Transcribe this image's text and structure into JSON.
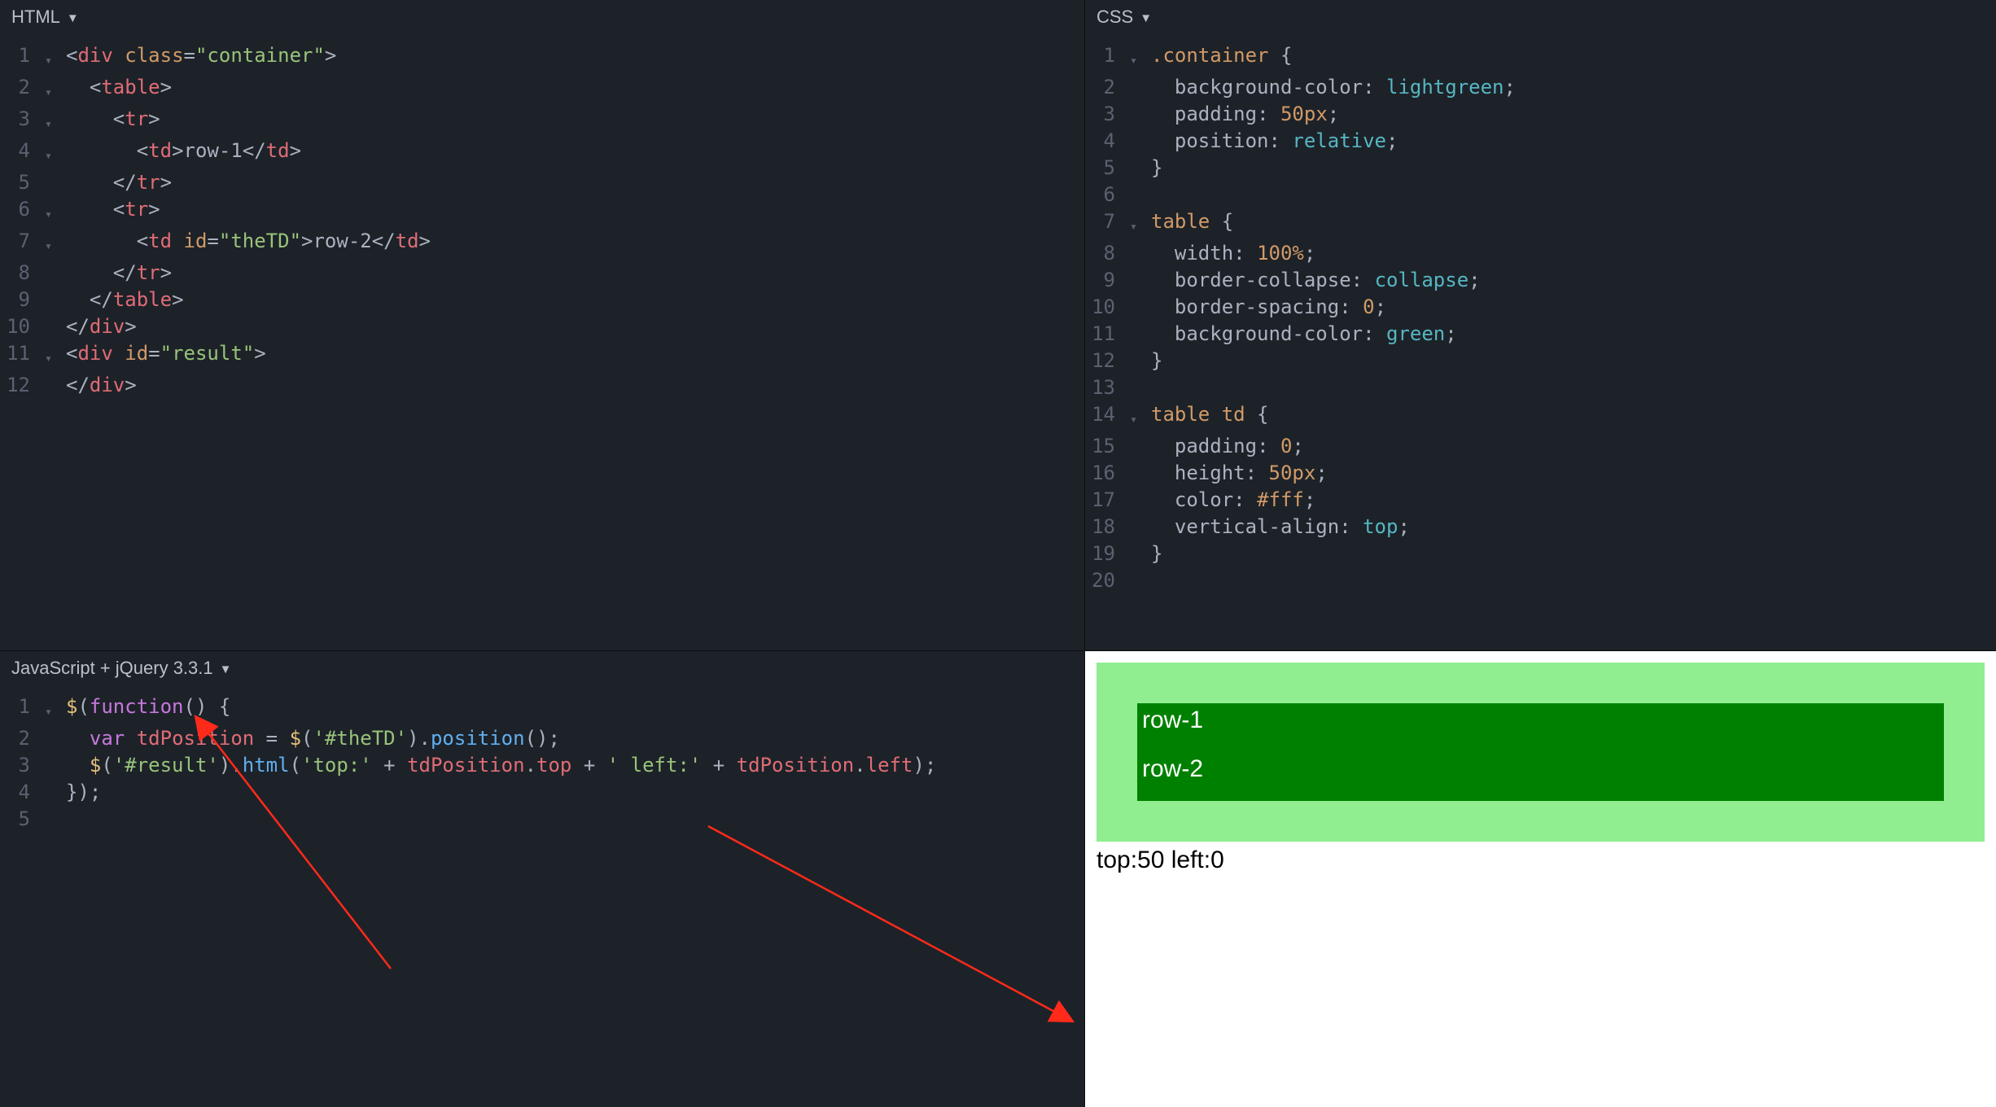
{
  "panes": {
    "html": {
      "title": "HTML"
    },
    "css": {
      "title": "CSS"
    },
    "js": {
      "title": "JavaScript + jQuery 3.3.1"
    }
  },
  "html_code": {
    "lines": [
      {
        "n": "1",
        "fold": "▾",
        "tokens": [
          [
            "angle",
            "<"
          ],
          [
            "tag",
            "div"
          ],
          [
            "text",
            " "
          ],
          [
            "attr",
            "class"
          ],
          [
            "eq",
            "="
          ],
          [
            "str",
            "\"container\""
          ],
          [
            "angle",
            ">"
          ]
        ]
      },
      {
        "n": "2",
        "fold": "▾",
        "tokens": [
          [
            "text",
            "  "
          ],
          [
            "angle",
            "<"
          ],
          [
            "tag",
            "table"
          ],
          [
            "angle",
            ">"
          ]
        ]
      },
      {
        "n": "3",
        "fold": "▾",
        "tokens": [
          [
            "text",
            "    "
          ],
          [
            "angle",
            "<"
          ],
          [
            "tag",
            "tr"
          ],
          [
            "angle",
            ">"
          ]
        ]
      },
      {
        "n": "4",
        "fold": "▾",
        "tokens": [
          [
            "text",
            "      "
          ],
          [
            "angle",
            "<"
          ],
          [
            "tag",
            "td"
          ],
          [
            "angle",
            ">"
          ],
          [
            "text",
            "row-1"
          ],
          [
            "angle",
            "</"
          ],
          [
            "tag",
            "td"
          ],
          [
            "angle",
            ">"
          ]
        ]
      },
      {
        "n": "5",
        "fold": "",
        "tokens": [
          [
            "text",
            "    "
          ],
          [
            "angle",
            "</"
          ],
          [
            "tag",
            "tr"
          ],
          [
            "angle",
            ">"
          ]
        ]
      },
      {
        "n": "6",
        "fold": "▾",
        "tokens": [
          [
            "text",
            "    "
          ],
          [
            "angle",
            "<"
          ],
          [
            "tag",
            "tr"
          ],
          [
            "angle",
            ">"
          ]
        ]
      },
      {
        "n": "7",
        "fold": "▾",
        "tokens": [
          [
            "text",
            "      "
          ],
          [
            "angle",
            "<"
          ],
          [
            "tag",
            "td"
          ],
          [
            "text",
            " "
          ],
          [
            "attr",
            "id"
          ],
          [
            "eq",
            "="
          ],
          [
            "str",
            "\"theTD\""
          ],
          [
            "angle",
            ">"
          ],
          [
            "text",
            "row-2"
          ],
          [
            "angle",
            "</"
          ],
          [
            "tag",
            "td"
          ],
          [
            "angle",
            ">"
          ]
        ]
      },
      {
        "n": "8",
        "fold": "",
        "tokens": [
          [
            "text",
            "    "
          ],
          [
            "angle",
            "</"
          ],
          [
            "tag",
            "tr"
          ],
          [
            "angle",
            ">"
          ]
        ]
      },
      {
        "n": "9",
        "fold": "",
        "tokens": [
          [
            "text",
            "  "
          ],
          [
            "angle",
            "</"
          ],
          [
            "tag",
            "table"
          ],
          [
            "angle",
            ">"
          ]
        ]
      },
      {
        "n": "10",
        "fold": "",
        "tokens": [
          [
            "angle",
            "</"
          ],
          [
            "tag",
            "div"
          ],
          [
            "angle",
            ">"
          ]
        ]
      },
      {
        "n": "11",
        "fold": "▾",
        "tokens": [
          [
            "angle",
            "<"
          ],
          [
            "tag",
            "div"
          ],
          [
            "text",
            " "
          ],
          [
            "attr",
            "id"
          ],
          [
            "eq",
            "="
          ],
          [
            "str",
            "\"result\""
          ],
          [
            "angle",
            ">"
          ]
        ]
      },
      {
        "n": "12",
        "fold": "",
        "tokens": [
          [
            "angle",
            "</"
          ],
          [
            "tag",
            "div"
          ],
          [
            "angle",
            ">"
          ]
        ]
      }
    ]
  },
  "css_code": {
    "lines": [
      {
        "n": "1",
        "fold": "▾",
        "tokens": [
          [
            "sel",
            ".container"
          ],
          [
            "text",
            " "
          ],
          [
            "brace",
            "{"
          ]
        ]
      },
      {
        "n": "2",
        "fold": "",
        "tokens": [
          [
            "text",
            "  "
          ],
          [
            "prop",
            "background-color"
          ],
          [
            "colon",
            ": "
          ],
          [
            "valkw",
            "lightgreen"
          ],
          [
            "semi",
            ";"
          ]
        ]
      },
      {
        "n": "3",
        "fold": "",
        "tokens": [
          [
            "text",
            "  "
          ],
          [
            "prop",
            "padding"
          ],
          [
            "colon",
            ": "
          ],
          [
            "val",
            "50px"
          ],
          [
            "semi",
            ";"
          ]
        ]
      },
      {
        "n": "4",
        "fold": "",
        "tokens": [
          [
            "text",
            "  "
          ],
          [
            "prop",
            "position"
          ],
          [
            "colon",
            ": "
          ],
          [
            "valkw",
            "relative"
          ],
          [
            "semi",
            ";"
          ]
        ]
      },
      {
        "n": "5",
        "fold": "",
        "tokens": [
          [
            "brace",
            "}"
          ]
        ]
      },
      {
        "n": "6",
        "fold": "",
        "tokens": [
          [
            "text",
            ""
          ]
        ]
      },
      {
        "n": "7",
        "fold": "▾",
        "tokens": [
          [
            "sel",
            "table"
          ],
          [
            "text",
            " "
          ],
          [
            "brace",
            "{"
          ]
        ]
      },
      {
        "n": "8",
        "fold": "",
        "tokens": [
          [
            "text",
            "  "
          ],
          [
            "prop",
            "width"
          ],
          [
            "colon",
            ": "
          ],
          [
            "val",
            "100%"
          ],
          [
            "semi",
            ";"
          ]
        ]
      },
      {
        "n": "9",
        "fold": "",
        "tokens": [
          [
            "text",
            "  "
          ],
          [
            "prop",
            "border-collapse"
          ],
          [
            "colon",
            ": "
          ],
          [
            "valkw",
            "collapse"
          ],
          [
            "semi",
            ";"
          ]
        ]
      },
      {
        "n": "10",
        "fold": "",
        "tokens": [
          [
            "text",
            "  "
          ],
          [
            "prop",
            "border-spacing"
          ],
          [
            "colon",
            ": "
          ],
          [
            "val",
            "0"
          ],
          [
            "semi",
            ";"
          ]
        ]
      },
      {
        "n": "11",
        "fold": "",
        "tokens": [
          [
            "text",
            "  "
          ],
          [
            "prop",
            "background-color"
          ],
          [
            "colon",
            ": "
          ],
          [
            "valkw",
            "green"
          ],
          [
            "semi",
            ";"
          ]
        ]
      },
      {
        "n": "12",
        "fold": "",
        "tokens": [
          [
            "brace",
            "}"
          ]
        ]
      },
      {
        "n": "13",
        "fold": "",
        "tokens": [
          [
            "text",
            ""
          ]
        ]
      },
      {
        "n": "14",
        "fold": "▾",
        "tokens": [
          [
            "sel",
            "table td"
          ],
          [
            "text",
            " "
          ],
          [
            "brace",
            "{"
          ]
        ]
      },
      {
        "n": "15",
        "fold": "",
        "tokens": [
          [
            "text",
            "  "
          ],
          [
            "prop",
            "padding"
          ],
          [
            "colon",
            ": "
          ],
          [
            "val",
            "0"
          ],
          [
            "semi",
            ";"
          ]
        ]
      },
      {
        "n": "16",
        "fold": "",
        "tokens": [
          [
            "text",
            "  "
          ],
          [
            "prop",
            "height"
          ],
          [
            "colon",
            ": "
          ],
          [
            "val",
            "50px"
          ],
          [
            "semi",
            ";"
          ]
        ]
      },
      {
        "n": "17",
        "fold": "",
        "tokens": [
          [
            "text",
            "  "
          ],
          [
            "prop",
            "color"
          ],
          [
            "colon",
            ": "
          ],
          [
            "val",
            "#fff"
          ],
          [
            "semi",
            ";"
          ]
        ]
      },
      {
        "n": "18",
        "fold": "",
        "tokens": [
          [
            "text",
            "  "
          ],
          [
            "prop",
            "vertical-align"
          ],
          [
            "colon",
            ": "
          ],
          [
            "valkw",
            "top"
          ],
          [
            "semi",
            ";"
          ]
        ]
      },
      {
        "n": "19",
        "fold": "",
        "tokens": [
          [
            "brace",
            "}"
          ]
        ]
      },
      {
        "n": "20",
        "fold": "",
        "tokens": [
          [
            "text",
            ""
          ]
        ]
      }
    ]
  },
  "js_code": {
    "lines": [
      {
        "n": "1",
        "fold": "▾",
        "tokens": [
          [
            "ident2",
            "$"
          ],
          [
            "paren",
            "("
          ],
          [
            "kw",
            "function"
          ],
          [
            "paren",
            "()"
          ],
          [
            "text",
            " "
          ],
          [
            "brace",
            "{"
          ]
        ]
      },
      {
        "n": "2",
        "fold": "",
        "tokens": [
          [
            "text",
            "  "
          ],
          [
            "kw",
            "var"
          ],
          [
            "text",
            " "
          ],
          [
            "ident",
            "tdPosition"
          ],
          [
            "text",
            " "
          ],
          [
            "eq",
            "="
          ],
          [
            "text",
            " "
          ],
          [
            "ident2",
            "$"
          ],
          [
            "paren",
            "("
          ],
          [
            "str",
            "'#theTD'"
          ],
          [
            "paren",
            ")"
          ],
          [
            "dot",
            "."
          ],
          [
            "fn",
            "position"
          ],
          [
            "paren",
            "()"
          ],
          [
            "semi",
            ";"
          ]
        ]
      },
      {
        "n": "3",
        "fold": "",
        "tokens": [
          [
            "text",
            "  "
          ],
          [
            "ident2",
            "$"
          ],
          [
            "paren",
            "("
          ],
          [
            "str",
            "'#result'"
          ],
          [
            "paren",
            ")"
          ],
          [
            "dot",
            "."
          ],
          [
            "fn",
            "html"
          ],
          [
            "paren",
            "("
          ],
          [
            "str",
            "'top:'"
          ],
          [
            "text",
            " "
          ],
          [
            "eq",
            "+"
          ],
          [
            "text",
            " "
          ],
          [
            "ident",
            "tdPosition"
          ],
          [
            "dot",
            "."
          ],
          [
            "ident",
            "top"
          ],
          [
            "text",
            " "
          ],
          [
            "eq",
            "+"
          ],
          [
            "text",
            " "
          ],
          [
            "str",
            "' left:'"
          ],
          [
            "text",
            " "
          ],
          [
            "eq",
            "+"
          ],
          [
            "text",
            " "
          ],
          [
            "ident",
            "tdPosition"
          ],
          [
            "dot",
            "."
          ],
          [
            "ident",
            "left"
          ],
          [
            "paren",
            ")"
          ],
          [
            "semi",
            ";"
          ]
        ]
      },
      {
        "n": "4",
        "fold": "",
        "tokens": [
          [
            "brace",
            "}"
          ],
          [
            "paren",
            ")"
          ],
          [
            "semi",
            ";"
          ]
        ]
      },
      {
        "n": "5",
        "fold": "",
        "tokens": [
          [
            "text",
            ""
          ]
        ]
      }
    ]
  },
  "preview": {
    "row1": "row-1",
    "row2": "row-2",
    "result": "top:50 left:0"
  }
}
